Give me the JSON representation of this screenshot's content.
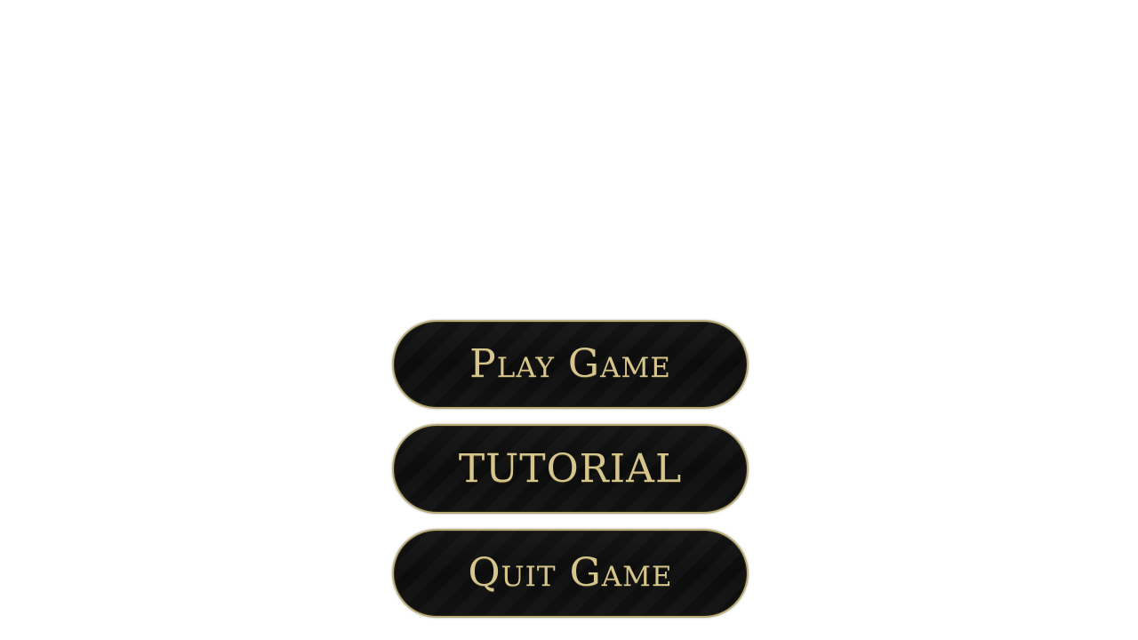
{
  "main_menu": {
    "play_label": "Play Game",
    "tutorial_label": "TUTORIAL",
    "quit_label": "Quit Game"
  },
  "colors": {
    "background": "#ffffff",
    "button_fill": "#0f0f0f",
    "button_border": "#b9ad7a",
    "label_gold": "#d6c68c"
  }
}
